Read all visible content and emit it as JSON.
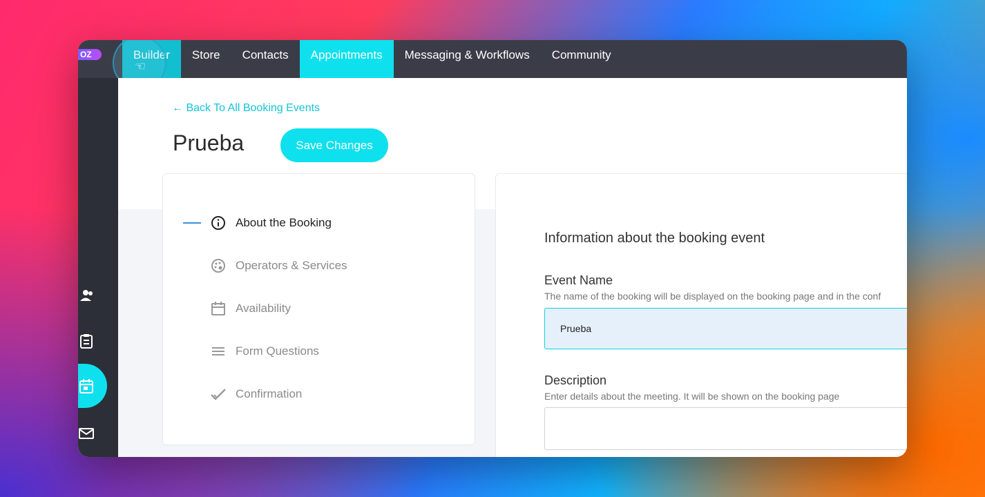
{
  "topbar": {
    "logo_text": "OZ",
    "nav": [
      "Builder",
      "Store",
      "Contacts",
      "Appointments",
      "Messaging & Workflows",
      "Community"
    ]
  },
  "page": {
    "back_link": "← Back To All Booking Events",
    "title": "Prueba",
    "save_button": "Save Changes"
  },
  "steps": [
    {
      "label": "About the Booking",
      "icon": "info-icon",
      "active": true
    },
    {
      "label": "Operators & Services",
      "icon": "palette-icon",
      "active": false
    },
    {
      "label": "Availability",
      "icon": "calendar-icon",
      "active": false
    },
    {
      "label": "Form Questions",
      "icon": "list-icon",
      "active": false
    },
    {
      "label": "Confirmation",
      "icon": "checkmark-icon",
      "active": false
    }
  ],
  "info": {
    "heading": "Information about the booking event",
    "event_name_label": "Event Name",
    "event_name_help": "The name of the booking will be displayed on the booking page and in the conf",
    "event_name_value": "Prueba",
    "description_label": "Description",
    "description_help": "Enter details about the meeting. It will be shown on the booking page",
    "description_value": ""
  },
  "colors": {
    "accent": "#0fe0ee",
    "topbar": "#3a3d48",
    "rail": "#2c2f38",
    "link": "#12c6d6"
  }
}
